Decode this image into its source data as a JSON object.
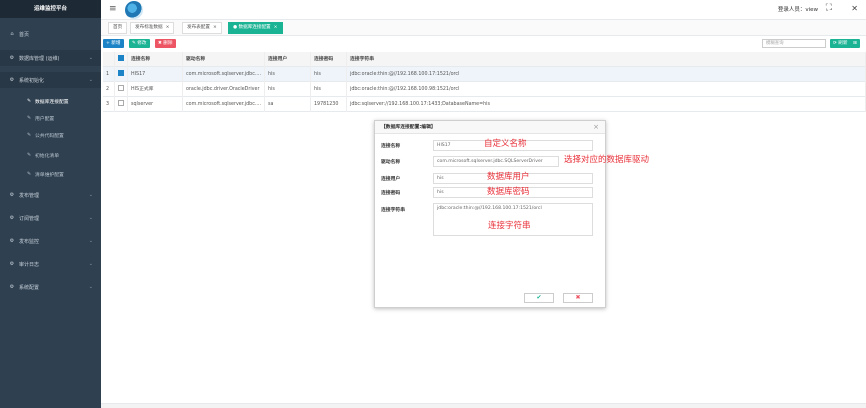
{
  "app": {
    "title": "运维监控平台",
    "login_label": "登录人员：view"
  },
  "sidebar": {
    "items": [
      {
        "label": "首页",
        "icon": "home-icon"
      },
      {
        "label": "数据库管理 (运维)",
        "icon": "gear-icon"
      },
      {
        "label": "系统初始化",
        "icon": "gear-icon"
      },
      {
        "label": "发布管理",
        "icon": "gear-icon"
      },
      {
        "label": "订阅管理",
        "icon": "gear-icon"
      },
      {
        "label": "发布监控",
        "icon": "gear-icon"
      },
      {
        "label": "审计日志",
        "icon": "gear-icon"
      },
      {
        "label": "系统配置",
        "icon": "gear-icon"
      }
    ],
    "sub_items": [
      {
        "label": "数据库连接配置"
      },
      {
        "label": "用户配置"
      },
      {
        "label": "公共代码配置"
      },
      {
        "label": "初始化清单"
      },
      {
        "label": "清单维护配置"
      }
    ]
  },
  "tabs": [
    {
      "label": "首页"
    },
    {
      "label": "发布标准数据"
    },
    {
      "label": "发布表配置"
    },
    {
      "label": "数据库连接配置"
    }
  ],
  "toolbar": {
    "add_label": "+ 新增",
    "edit_label": "✎ 修改",
    "delete_label": "✖ 删除",
    "search_placeholder": "模糊查询",
    "refresh_label": "⟳ 刷新",
    "more_label": "⊞"
  },
  "table": {
    "headers": [
      "连接名称",
      "驱动名称",
      "连接用户",
      "连接密码",
      "连接字符串"
    ],
    "rows": [
      {
        "num": "1",
        "checked": true,
        "name": "HIS17",
        "driver": "com.microsoft.sqlserver.jdbc....",
        "user": "his",
        "password": "his",
        "conn": "jdbc:oracle:thin:@//192.168.100.17:1521/orcl"
      },
      {
        "num": "2",
        "checked": false,
        "name": "HIS正式库",
        "driver": "oracle.jdbc.driver.OracleDriver",
        "user": "his",
        "password": "his",
        "conn": "jdbc:oracle:thin:@//192.168.100.98:1521/orcl"
      },
      {
        "num": "3",
        "checked": false,
        "name": "sqlserver",
        "driver": "com.microsoft.sqlserver.jdbc....",
        "user": "sa",
        "password": "19781230",
        "conn": "jdbc:sqlserver://192.168.100.17:1433;DatabaseName=his"
      }
    ]
  },
  "dialog": {
    "title": "【数据库连接配置:编辑】",
    "fields": [
      {
        "label": "连接名称",
        "value": "HIS17",
        "annotation": "自定义名称"
      },
      {
        "label": "驱动名称",
        "value": "com.microsoft.sqlserver.jdbc.SQLServerDriver",
        "annotation": "选择对应的数据库驱动"
      },
      {
        "label": "连接用户",
        "value": "his",
        "annotation": "数据库用户"
      },
      {
        "label": "连接密码",
        "value": "his",
        "annotation": "数据库密码"
      },
      {
        "label": "连接字符串",
        "value": "jdbc:oracle:thin:@//192.168.100.17:1521/orcl",
        "annotation": "连接字符串"
      }
    ],
    "ok_icon": "✔",
    "cancel_icon": "✖"
  },
  "colors": {
    "sidebar_bg": "#2f4050",
    "accent_green": "#1ab394",
    "accent_blue": "#1c84c6",
    "danger_red": "#ed5565",
    "annotation_red": "#e8313a"
  }
}
